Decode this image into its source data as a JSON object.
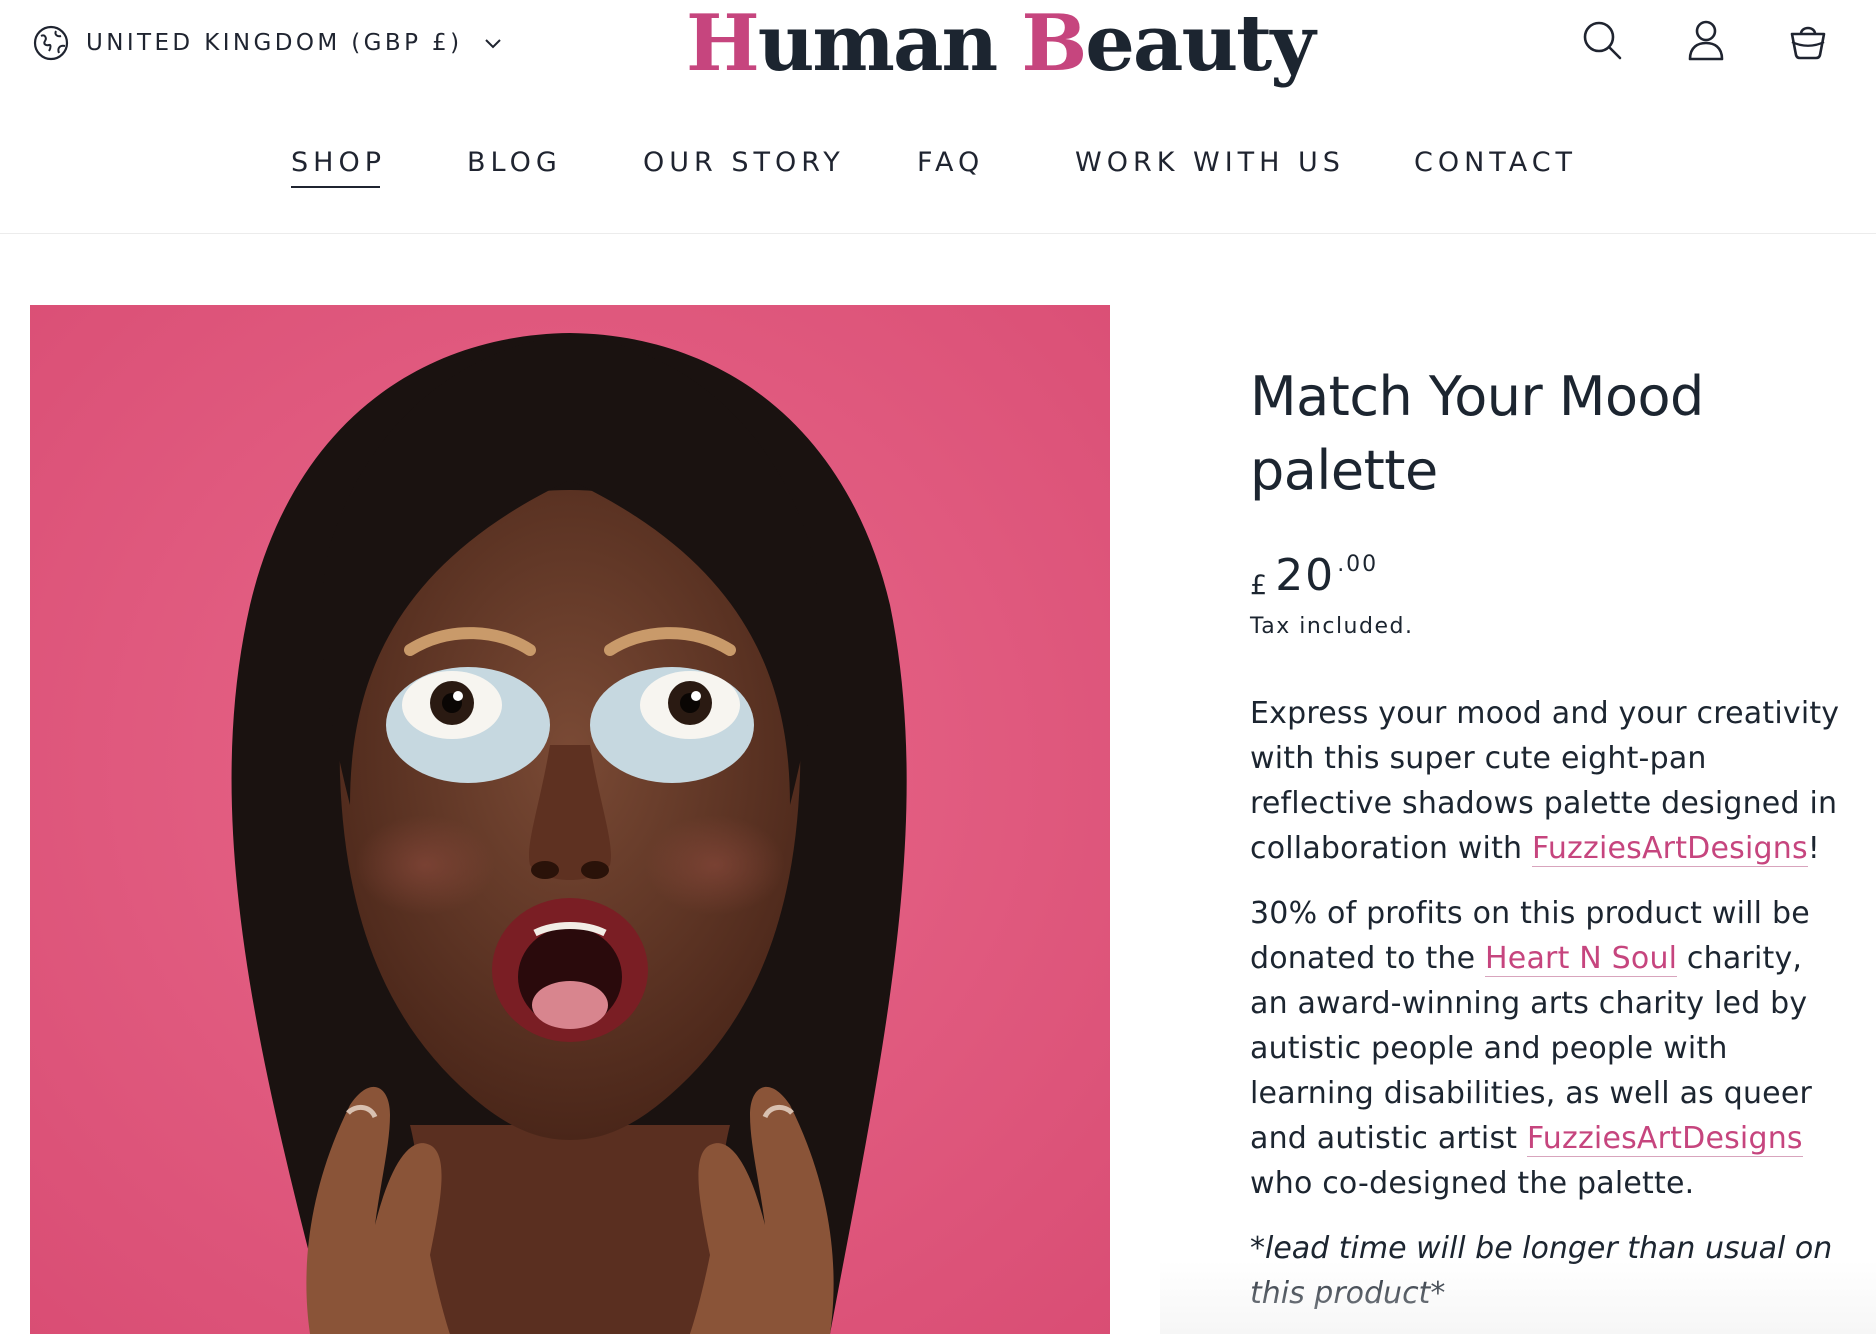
{
  "header": {
    "locale": {
      "label": "UNITED KINGDOM (GBP £)",
      "icon": "globe-icon",
      "chevron": "chevron-down-icon"
    },
    "logo": {
      "first_cap": "H",
      "first_rest": "uman ",
      "second_cap": "B",
      "second_rest": "eauty",
      "accent": "#c6457e",
      "dark": "#1c2530"
    },
    "icons": {
      "search": "search-icon",
      "account": "account-icon",
      "cart": "shopping-bag-icon"
    },
    "nav": [
      {
        "label": "SHOP",
        "active": true
      },
      {
        "label": "BLOG"
      },
      {
        "label": "OUR STORY"
      },
      {
        "label": "FAQ"
      },
      {
        "label": "WORK WITH US"
      },
      {
        "label": "CONTACT"
      }
    ]
  },
  "product": {
    "image": {
      "background": "#df5a7e"
    },
    "title_line1": "Match Your Mood",
    "title_line2": "palette",
    "price": {
      "currency": "£",
      "main": "20",
      "cents": ".00"
    },
    "tax_note": "Tax included.",
    "desc1": {
      "text": "Express your mood and your creativity with this super cute eight-pan reflective shadows palette designed in collaboration with ",
      "link": "FuzziesArtDesigns",
      "end": "!"
    },
    "desc2": {
      "text_a": "30% of profits on this product will be donated to the ",
      "link_a": "Heart N Soul",
      "text_b": " charity, an award-winning arts charity led by autistic people and people with learning disabilities, as well as queer and autistic artist ",
      "link_b": "FuzziesArtDesigns",
      "text_c": " who co-designed the palette."
    },
    "note": "*lead time will be longer than usual on this product*"
  },
  "colors": {
    "accent": "#c6457e",
    "text": "#1c2530",
    "image_bg": "#df5a7e"
  }
}
